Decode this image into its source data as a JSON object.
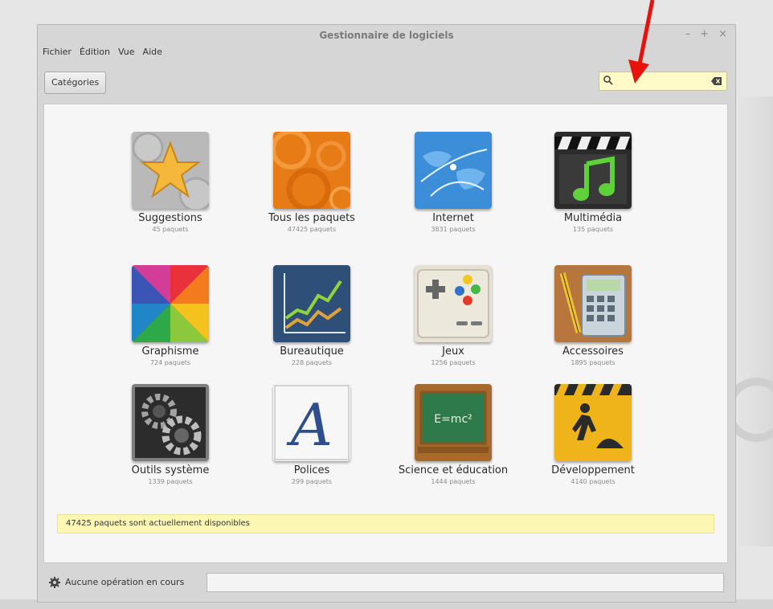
{
  "window": {
    "title": "Gestionnaire de logiciels",
    "controls": [
      "–",
      "+",
      "×"
    ]
  },
  "menu": [
    "Fichier",
    "Édition",
    "Vue",
    "Aide"
  ],
  "toolbar": {
    "categories_label": "Catégories",
    "search_value": ""
  },
  "categories": [
    {
      "name": "Suggestions",
      "count": "45 paquets",
      "icon": "star-icon"
    },
    {
      "name": "Tous les paquets",
      "count": "47425 paquets",
      "icon": "gears-icon"
    },
    {
      "name": "Internet",
      "count": "3831 paquets",
      "icon": "globe-icon"
    },
    {
      "name": "Multimédia",
      "count": "135 paquets",
      "icon": "clapper-music-icon"
    },
    {
      "name": "Graphisme",
      "count": "724 paquets",
      "icon": "color-wheel-icon"
    },
    {
      "name": "Bureautique",
      "count": "228 paquets",
      "icon": "chart-icon"
    },
    {
      "name": "Jeux",
      "count": "1256 paquets",
      "icon": "gamepad-icon"
    },
    {
      "name": "Accessoires",
      "count": "1895 paquets",
      "icon": "calculator-icon"
    },
    {
      "name": "Outils système",
      "count": "1339 paquets",
      "icon": "system-gears-icon"
    },
    {
      "name": "Polices",
      "count": "299 paquets",
      "icon": "font-icon"
    },
    {
      "name": "Science et éducation",
      "count": "1444 paquets",
      "icon": "chalkboard-icon"
    },
    {
      "name": "Développement",
      "count": "4140 paquets",
      "icon": "construction-icon"
    }
  ],
  "info_bar": "47425 paquets sont actuellement disponibles",
  "status": "Aucune opération en cours",
  "colors": {
    "search_bg": "#fffbc8",
    "info_bg": "#fcf8b4",
    "arrow": "#e8120c"
  }
}
